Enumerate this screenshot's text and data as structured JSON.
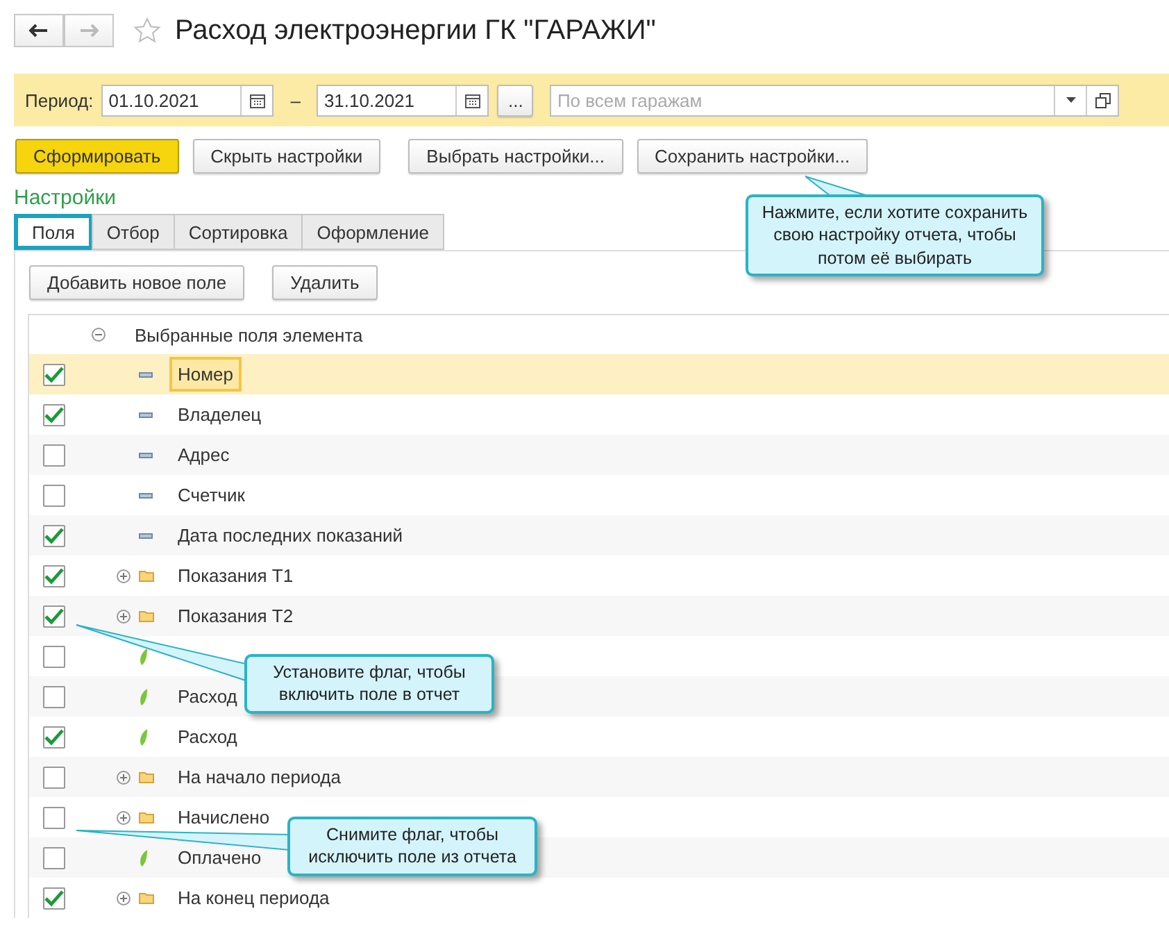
{
  "window": {
    "title": "Расход электроэнергии ГК \"ГАРАЖИ\"",
    "favorite": false
  },
  "filter_bar": {
    "period_label": "Период:",
    "date_from": "01.10.2021",
    "separator": "–",
    "date_to": "31.10.2021",
    "more_button": "...",
    "garage_placeholder": "По всем гаражам"
  },
  "buttons": [
    {
      "label": "Сформировать",
      "primary": true
    },
    {
      "label": "Скрыть настройки",
      "primary": false
    },
    {
      "label": "Выбрать настройки...",
      "primary": false
    },
    {
      "label": "Сохранить настройки...",
      "primary": false
    }
  ],
  "settings_title": "Настройки",
  "tabs": [
    {
      "label": "Поля",
      "selected": true
    },
    {
      "label": "Отбор",
      "selected": false
    },
    {
      "label": "Сортировка",
      "selected": false
    },
    {
      "label": "Оформление",
      "selected": false
    }
  ],
  "toolbar": [
    "Добавить новое поле",
    "Удалить"
  ],
  "tree": {
    "label": "Выбранные поля элемента",
    "expanded": true,
    "children": [
      {
        "label": "Номер",
        "kind": "field",
        "checked": true,
        "selected": true
      },
      {
        "label": "Владелец",
        "kind": "field",
        "checked": true,
        "selected": false
      },
      {
        "label": "Адрес",
        "kind": "field",
        "checked": false,
        "selected": false
      },
      {
        "label": "Счетчик",
        "kind": "field",
        "checked": false,
        "selected": false
      },
      {
        "label": "Дата последних показаний",
        "kind": "field",
        "checked": true,
        "selected": false
      },
      {
        "label": "Показания Т1",
        "kind": "folder",
        "expanded": false,
        "checked": true,
        "selected": false
      },
      {
        "label": "Показания Т2",
        "kind": "folder",
        "expanded": false,
        "checked": true,
        "selected": false
      },
      {
        "kind": "resource",
        "checked": false,
        "selected": false
      },
      {
        "label": "Расход",
        "kind": "resource",
        "checked": false,
        "selected": false
      },
      {
        "label": "Расход",
        "kind": "resource",
        "checked": true,
        "selected": false
      },
      {
        "label": "На начало периода",
        "kind": "folder",
        "expanded": false,
        "checked": false,
        "selected": false
      },
      {
        "label": "Начислено",
        "kind": "folder",
        "expanded": false,
        "checked": false,
        "selected": false
      },
      {
        "label": "Оплачено",
        "kind": "resource",
        "checked": false,
        "selected": false
      },
      {
        "label": "На конец периода",
        "kind": "folder",
        "expanded": false,
        "checked": true,
        "selected": false
      }
    ]
  },
  "callouts": [
    "Нажмите, если хотите сохранить свою настройку отчета, чтобы потом её выбирать",
    "Установите флаг, чтобы включить поле в отчет",
    "Снимите флаг, чтобы исключить поле из отчета"
  ]
}
